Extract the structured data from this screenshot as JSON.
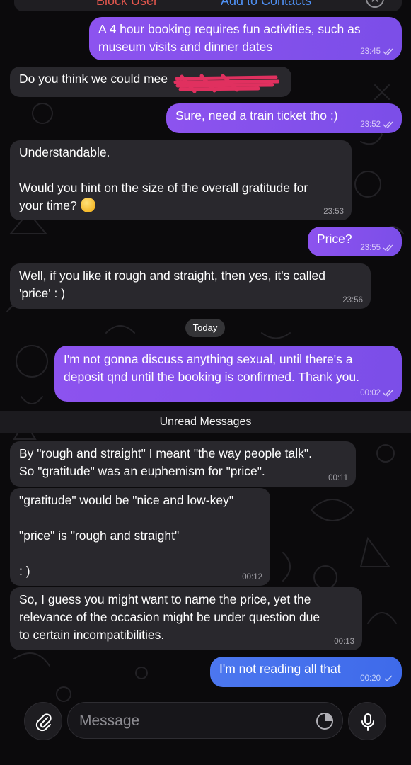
{
  "header": {
    "block_label": "Block User",
    "add_label": "Add to Contacts"
  },
  "messages": [
    {
      "dir": "out",
      "text": "A 4 hour booking requires fun activities, such as\nmuseum visits and dinner dates",
      "time": "23:45",
      "read": true
    },
    {
      "dir": "in",
      "text": "Do you think we could mee",
      "time": "",
      "redacted": true
    },
    {
      "dir": "out",
      "text": "Sure, need a train ticket tho :)",
      "time": "23:52",
      "read": true
    },
    {
      "dir": "in",
      "text": "Understandable.\n\nWould you hint on the size of the overall gratitude for\nyour time?",
      "time": "23:53",
      "emoji": "grinning-sweat-emoji"
    },
    {
      "dir": "out",
      "text": "Price?",
      "time": "23:55",
      "read": true
    },
    {
      "dir": "in",
      "text": "Well, if you like it rough and straight, then yes, it's called\n'price' : )",
      "time": "23:56"
    },
    {
      "dir": "out",
      "text": "I'm not gonna discuss anything sexual, until there's a\ndeposit qnd until the booking is confirmed. Thank you.",
      "time": "00:02",
      "read": true
    },
    {
      "dir": "in",
      "text": "By \"rough and straight\" I meant \"the way people talk\".\nSo \"gratitude\" was an euphemism for \"price\".",
      "time": "00:11"
    },
    {
      "dir": "in",
      "text": "\"gratitude\" would be \"nice and low-key\"\n\n\"price\" is \"rough and straight\"\n\n: )",
      "time": "00:12"
    },
    {
      "dir": "in",
      "text": "So, I guess you might want to name the price, yet the\nrelevance of the occasion might be under question due\nto certain incompatibilities.",
      "time": "00:13"
    },
    {
      "dir": "out",
      "text": "I'm not reading all that",
      "time": "00:20",
      "read": false
    }
  ],
  "day_separator": "Today",
  "unread_label": "Unread Messages",
  "composer": {
    "placeholder": "Message",
    "attach_icon": "paperclip-icon",
    "sticker_icon": "sticker-icon",
    "mic_icon": "microphone-icon"
  },
  "colors": {
    "background": "#0b0a0c",
    "incoming_bubble": "#29282d",
    "outgoing_bubble": "#8d53ef",
    "outgoing_bubble_last": "#4c77ef",
    "redaction": "#e0305f",
    "block_red": "#e0564d",
    "link_blue": "#4f90f3"
  }
}
